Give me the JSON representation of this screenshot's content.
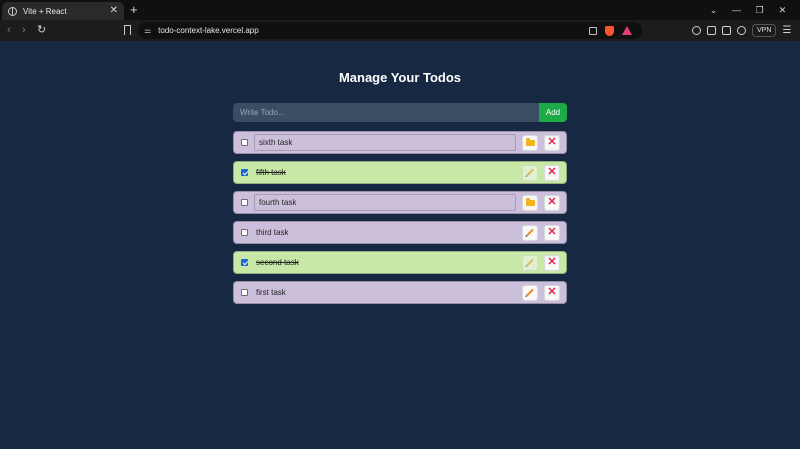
{
  "browser": {
    "tab_title": "Vite + React",
    "tab_close": "✕",
    "new_tab": "+",
    "url": "todo-context-lake.vercel.app",
    "vpn_label": "VPN",
    "window_controls": [
      "⌄",
      "—",
      "❐",
      "✕"
    ]
  },
  "app": {
    "title": "Manage Your Todos",
    "input_placeholder": "Write Todo...",
    "input_value": "",
    "add_label": "Add"
  },
  "todos": [
    {
      "text": "sixth task",
      "completed": false,
      "editing": true,
      "edit_icon": "folder-icon"
    },
    {
      "text": "fifth task",
      "completed": true,
      "editing": false,
      "edit_icon": "pencil-icon"
    },
    {
      "text": "fourth task",
      "completed": false,
      "editing": true,
      "edit_icon": "folder-icon"
    },
    {
      "text": "third task",
      "completed": false,
      "editing": false,
      "edit_icon": "pencil-icon"
    },
    {
      "text": "second task",
      "completed": true,
      "editing": false,
      "edit_icon": "pencil-icon"
    },
    {
      "text": "first task",
      "completed": false,
      "editing": false,
      "edit_icon": "pencil-icon"
    }
  ],
  "colors": {
    "page_background": "#172842",
    "pending_row": "#ccbfdc",
    "completed_row": "#c8e8a8",
    "add_button": "#1faa48",
    "delete_icon": "#e5264e"
  },
  "icons": {
    "delete": "✕"
  }
}
